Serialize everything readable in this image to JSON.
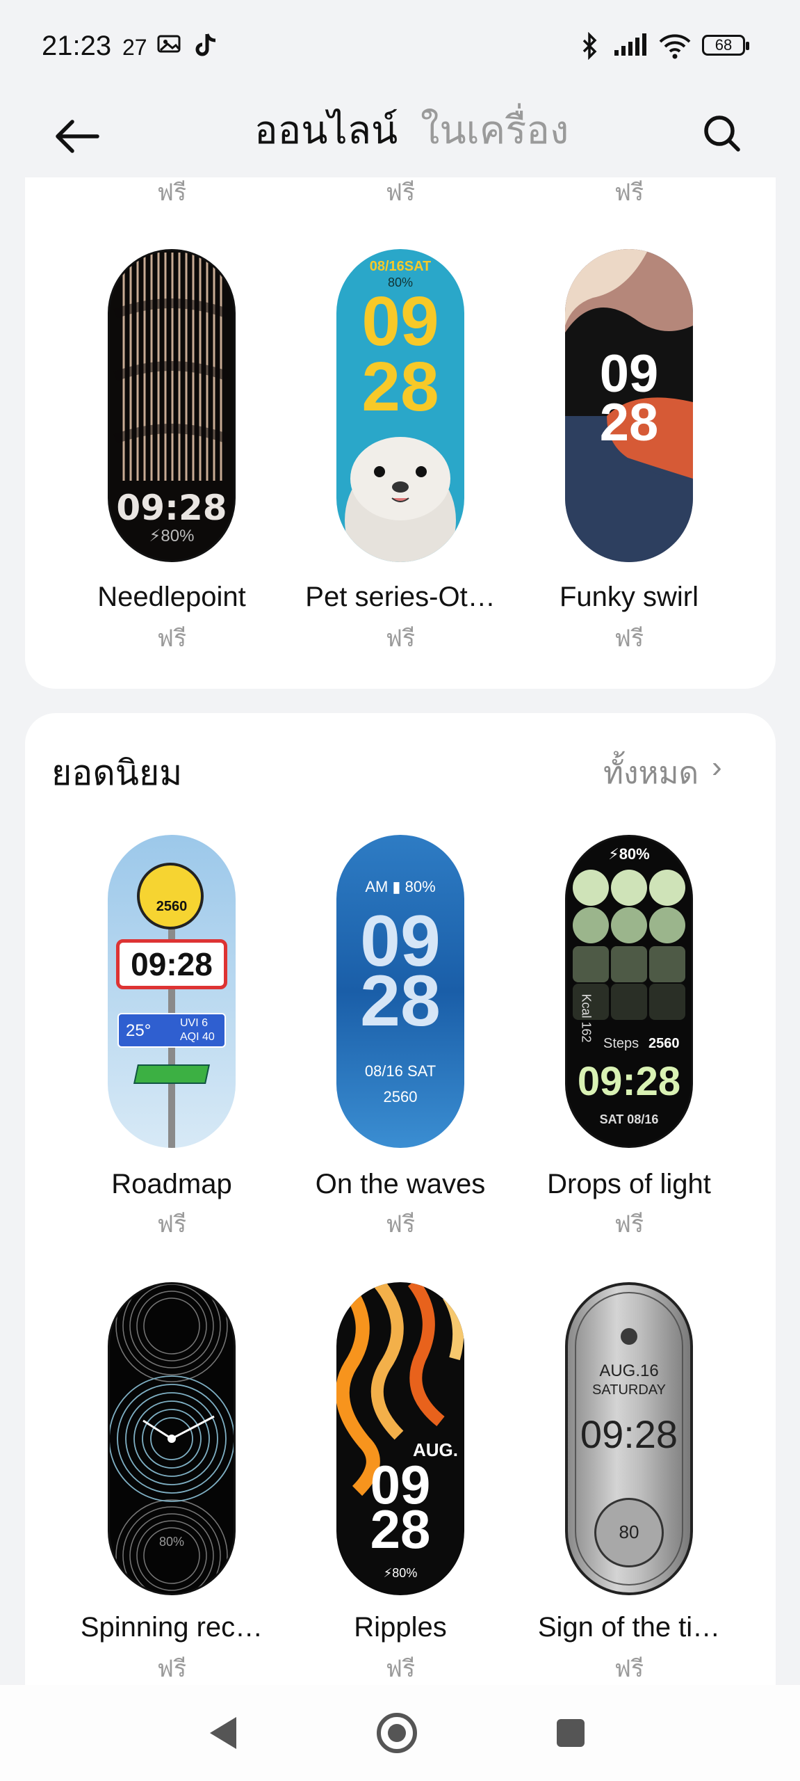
{
  "status_bar": {
    "time": "21:23",
    "date": "27",
    "battery": "68"
  },
  "header": {
    "tab_online": "ออนไลน์",
    "tab_local": "ในเครื่อง"
  },
  "top_row_prices": [
    "ฟรี",
    "ฟรี",
    "ฟรี"
  ],
  "featured": [
    {
      "name": "Needlepoint",
      "price": "ฟรี",
      "face_time": "09:28",
      "face_battery": "⚡80%"
    },
    {
      "name": "Pet series-Ot…",
      "price": "ฟรี",
      "face_date": "08/16SAT",
      "face_battery": "80%",
      "face_hour": "09",
      "face_min": "28"
    },
    {
      "name": "Funky swirl",
      "price": "ฟรี",
      "face_hour": "09",
      "face_min": "28"
    }
  ],
  "popular": {
    "title": "ยอดนิยม",
    "see_all": "ทั้งหมด",
    "items": [
      {
        "name": "Roadmap",
        "price": "ฟรี",
        "face_steps": "2560",
        "face_time": "09:28",
        "face_temp": "25°",
        "face_uvi": "UVI 6",
        "face_aqi": "AQI 40"
      },
      {
        "name": "On the waves",
        "price": "ฟรี",
        "face_top": "AM ▮ 80%",
        "face_hour": "09",
        "face_min": "28",
        "face_date": "08/16  SAT",
        "face_steps": "2560"
      },
      {
        "name": "Drops of light",
        "price": "ฟรี",
        "face_battery": "⚡80%",
        "face_kcal": "Kcal 162",
        "face_steps_label": "Steps",
        "face_steps": "2560",
        "face_time": "09:28",
        "face_date": "SAT 08/16"
      },
      {
        "name": "Spinning rec…",
        "price": "ฟรี",
        "face_battery": "80%"
      },
      {
        "name": "Ripples",
        "price": "ฟรี",
        "face_month": "AUG.",
        "face_hour": "09",
        "face_min": "28",
        "face_battery": "⚡80%"
      },
      {
        "name": "Sign of the ti…",
        "price": "ฟรี",
        "face_date": "AUG.16",
        "face_day": "SATURDAY",
        "face_time": "09:28",
        "face_battery": "80"
      }
    ]
  },
  "bottom_prices": [
    "ฟรี",
    "ฟรี",
    "ฟรี"
  ]
}
